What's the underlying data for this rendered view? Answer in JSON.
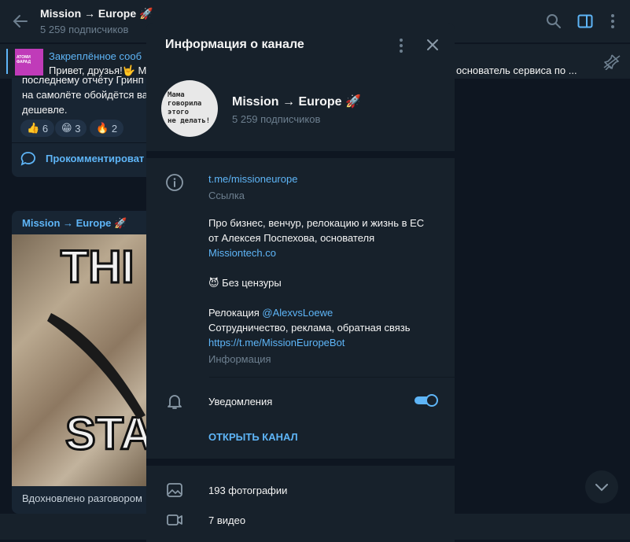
{
  "header": {
    "title": "Mission → Europe 🚀",
    "subtitle": "5 259 подписчиков"
  },
  "pinned": {
    "title": "Закреплённое сооб",
    "text": "Привет, друзья!🤟 М",
    "text_right": "основатель сервиса по ...",
    "thumb_label": "ATOMИ ФАРАД"
  },
  "message1": {
    "line1": "последнему отчёту Гринп",
    "line2": "на самолёте обойдётся ва",
    "line3": "дешевле.",
    "reactions": [
      {
        "emoji": "👍",
        "count": "6"
      },
      {
        "emoji": "😁",
        "count": "3"
      },
      {
        "emoji": "🔥",
        "count": "2"
      }
    ],
    "comment_label": "Прокомментироват"
  },
  "message2": {
    "author": "Mission → Europe 🚀",
    "meme_top": "THI",
    "meme_bottom": "STA",
    "caption": "Вдохновлено разговором"
  },
  "modal": {
    "title": "Информация о канале",
    "avatar_text": [
      "Мама",
      "говорила",
      "этого",
      "не делать!"
    ],
    "channel_name": "Mission → Europe 🚀",
    "subscribers": "5 259 подписчиков",
    "link": "t.me/missioneurope",
    "link_label": "Ссылка",
    "description": {
      "line1": "Про бизнес, венчур, релокацию и жизнь в ЕС",
      "line2": "от Алексея Поспехова, основателя",
      "line3_link": "Missiontech.co",
      "line4": "😈 Без цензуры",
      "line5_prefix": "Релокация ",
      "line5_link": "@AlexvsLoewe",
      "line6": "Сотрудничество, реклама, обратная связь",
      "line7_link": "https://t.me/MissionEuropeBot"
    },
    "info_label": "Информация",
    "notifications_label": "Уведомления",
    "notifications_enabled": true,
    "open_channel": "ОТКРЫТЬ КАНАЛ",
    "photos": "193 фотографии",
    "videos": "7 видео"
  },
  "colors": {
    "accent": "#5eb5f7",
    "bg": "#0e1621",
    "panel": "#17212b"
  }
}
